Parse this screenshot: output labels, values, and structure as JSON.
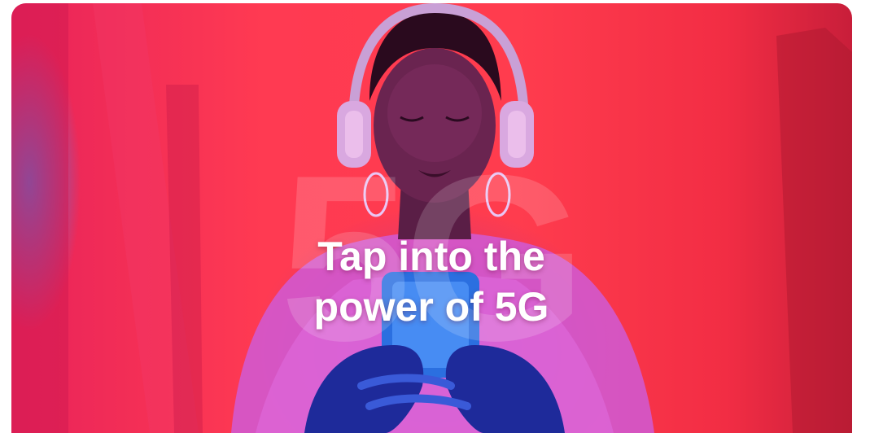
{
  "banner": {
    "watermark": "5G",
    "headline": {
      "line1": "Tap into the",
      "line2": "power of 5G"
    }
  },
  "colors": {
    "background": "#ff3a52",
    "accent_pink": "#e8235a",
    "accent_blue": "#288cff",
    "text": "#ffffff"
  }
}
